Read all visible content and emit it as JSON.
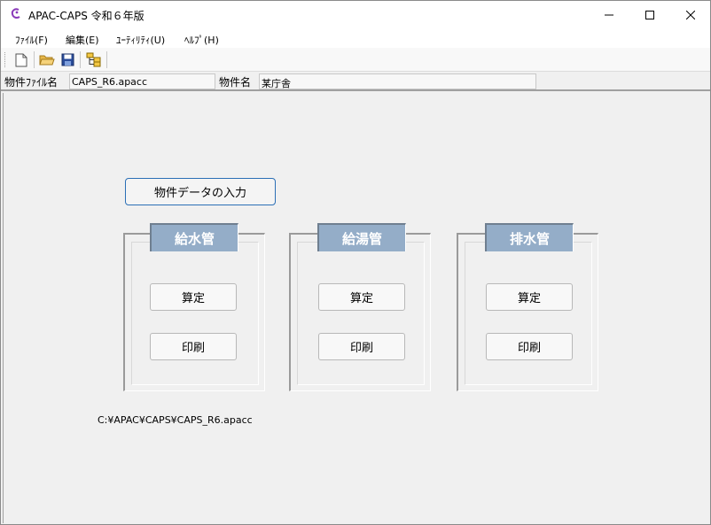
{
  "window": {
    "title": "APAC-CAPS 令和６年版"
  },
  "menu": {
    "file": "ﾌｧｲﾙ(F)",
    "edit": "編集(E)",
    "utility": "ﾕｰﾃｨﾘﾃｨ(U)",
    "help": "ﾍﾙﾌﾟ(H)"
  },
  "info": {
    "file_label": "物件ﾌｧｲﾙ名",
    "file_value": "CAPS_R6.apacc",
    "name_label": "物件名",
    "name_value": "某庁舎"
  },
  "main": {
    "input_button": "物件データの入力",
    "groups": [
      {
        "title": "給水管",
        "calc": "算定",
        "print": "印刷"
      },
      {
        "title": "給湯管",
        "calc": "算定",
        "print": "印刷"
      },
      {
        "title": "排水管",
        "calc": "算定",
        "print": "印刷"
      }
    ],
    "path": "C:¥APAC¥CAPS¥CAPS_R6.apacc"
  }
}
